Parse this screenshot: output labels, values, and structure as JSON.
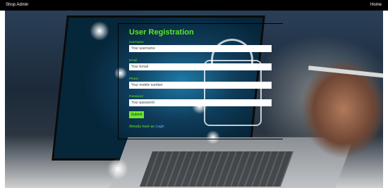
{
  "header": {
    "brand": "Shop Admin",
    "home_link": "Home"
  },
  "form": {
    "title": "User Registration",
    "fields": [
      {
        "label": "Username",
        "placeholder": "Your username"
      },
      {
        "label": "Email",
        "placeholder": "Your Email"
      },
      {
        "label": "Phone",
        "placeholder": "Your mobile number"
      },
      {
        "label": "Password",
        "placeholder": "Your password"
      }
    ],
    "submit_label": "Submit",
    "login_prefix": "Already have an",
    "login_link": "Login"
  },
  "colors": {
    "accent_green": "#5ce81e",
    "button_green": "#6fe62d",
    "link_blue": "#6ab4ff",
    "topbar_black": "#000000"
  }
}
